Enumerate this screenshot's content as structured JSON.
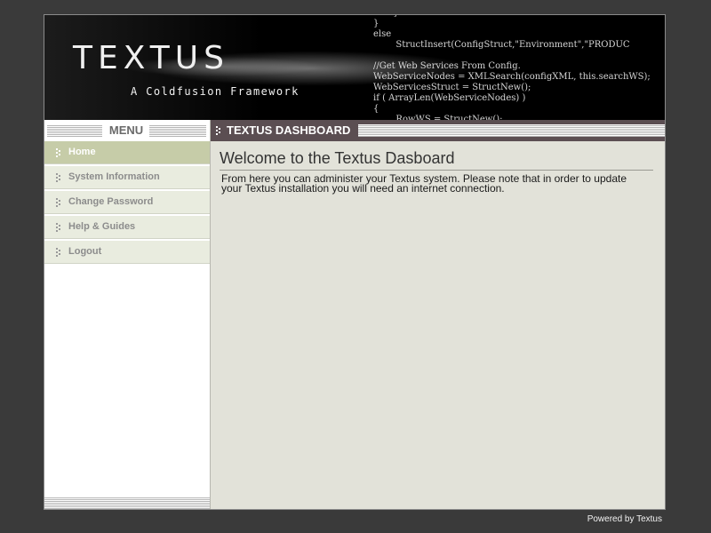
{
  "banner": {
    "logo_title": "TEXTUS",
    "logo_subtitle": "A Coldfusion Framework",
    "code_text": "       }\n}\nelse\n        StructInsert(ConfigStruct,\"Environment\",\"PRODUC\n\n//Get Web Services From Config.\nWebServiceNodes = XMLSearch(configXML, this.searchWS);\nWebServicesStruct = StructNew();\nif ( ArrayLen(WebServiceNodes) )\n{\n        RowWS = StructNew();"
  },
  "sidebar": {
    "menu_title": "MENU",
    "items": [
      {
        "label": "Home",
        "active": true
      },
      {
        "label": "System Information",
        "active": false
      },
      {
        "label": "Change Password",
        "active": false
      },
      {
        "label": "Help & Guides",
        "active": false
      },
      {
        "label": "Logout",
        "active": false
      }
    ]
  },
  "main": {
    "header_title": "TEXTUS DASHBOARD",
    "welcome_heading": "Welcome to the Textus Dasboard",
    "intro_text": "From here you can administer your Textus system. Please note that in order to update your Textus installation you will need an internet connection."
  },
  "footer": {
    "powered_by": "Powered by Textus"
  },
  "colors": {
    "page_background": "#3a3a3a",
    "banner_background": "#000000",
    "nav_active": "#c6cca8",
    "nav_inactive": "#e9ecdf",
    "main_header": "#5b4e52",
    "main_background": "#e2e2d9"
  }
}
